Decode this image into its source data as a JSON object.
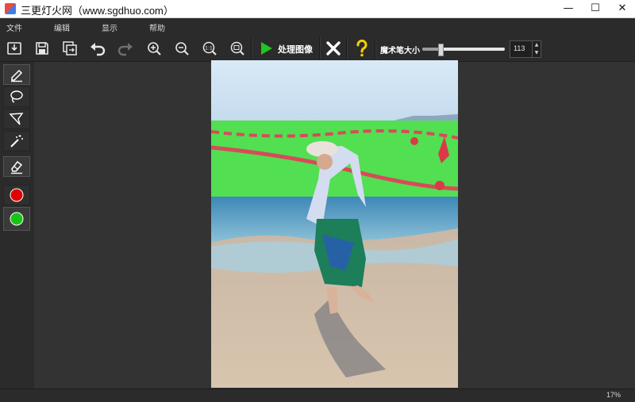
{
  "window": {
    "title": "三更灯火网（www.sgdhuo.com）",
    "minimize": "—",
    "maximize": "☐",
    "close": "✕"
  },
  "menu": [
    "文件",
    "编辑",
    "显示",
    "帮助"
  ],
  "toolbar": {
    "process_label": "处理图像",
    "brush_size_label": "魔术笔大小",
    "brush_size_value": "113",
    "brush_size_fraction": 0.22,
    "icons": [
      "import-icon",
      "save-icon",
      "export-icon",
      "undo-icon",
      "redo-icon",
      "zoom-in-icon",
      "zoom-out-icon",
      "actual-size-icon",
      "fit-window-icon",
      "play-icon",
      "close-x-icon",
      "help-icon"
    ]
  },
  "left_tools": [
    "pen-marker-icon",
    "lasso-icon",
    "polygon-lasso-icon",
    "magic-wand-icon",
    "eraser-icon",
    "red-color-icon",
    "green-color-icon"
  ],
  "colors": {
    "keep": "#e00000",
    "remove": "#18c418",
    "accent_green": "#22c322",
    "help_yellow": "#f2d200"
  },
  "status": {
    "zoom": "17%"
  }
}
